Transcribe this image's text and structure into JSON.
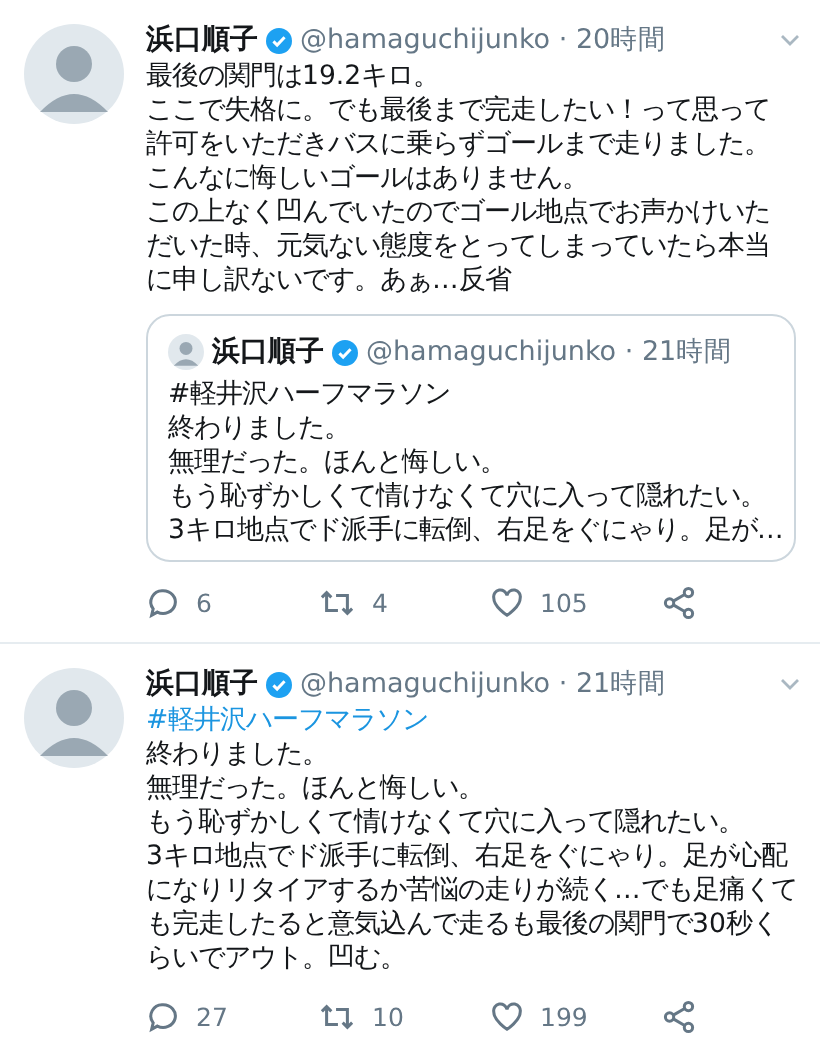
{
  "tweets": [
    {
      "author": "浜口順子",
      "verified": true,
      "meta": "@hamaguchijunko · 20時間",
      "lines": [
        {
          "kind": "text",
          "text": "最後の関門は19.2キロ。"
        },
        {
          "kind": "text",
          "text": "ここで失格に。でも最後まで完走したい！って思って"
        },
        {
          "kind": "text",
          "text": "許可をいただきバスに乗らずゴールまで走りました。"
        },
        {
          "kind": "text",
          "text": "こんなに悔しいゴールはありません。"
        },
        {
          "kind": "text",
          "text": "この上なく凹んでいたのでゴール地点でお声かけいた"
        },
        {
          "kind": "text",
          "text": "だいた時、元気ない態度をとってしまっていたら本当"
        },
        {
          "kind": "text",
          "text": "に申し訳ないです。あぁ…反省"
        }
      ],
      "quote": {
        "author": "浜口順子",
        "verified": true,
        "meta": "@hamaguchijunko · 21時間",
        "lines": [
          {
            "kind": "text",
            "text": "#軽井沢ハーフマラソン"
          },
          {
            "kind": "text",
            "text": "終わりました。"
          },
          {
            "kind": "text",
            "text": "無理だった。ほんと悔しい。"
          },
          {
            "kind": "text",
            "text": "もう恥ずかしくて情けなくて穴に入って隠れたい。"
          },
          {
            "kind": "text",
            "text": "3キロ地点でド派手に転倒、右足をぐにゃり。足が…"
          }
        ]
      },
      "replies": "6",
      "retweets": "4",
      "likes": "105"
    },
    {
      "author": "浜口順子",
      "verified": true,
      "meta": "@hamaguchijunko · 21時間",
      "lines": [
        {
          "kind": "hashtag",
          "text": "#軽井沢ハーフマラソン"
        },
        {
          "kind": "text",
          "text": "終わりました。"
        },
        {
          "kind": "text",
          "text": "無理だった。ほんと悔しい。"
        },
        {
          "kind": "text",
          "text": "もう恥ずかしくて情けなくて穴に入って隠れたい。"
        },
        {
          "kind": "text",
          "text": "3キロ地点でド派手に転倒、右足をぐにゃり。足が心配"
        },
        {
          "kind": "text",
          "text": "になりリタイアするか苦悩の走りが続く…でも足痛くて"
        },
        {
          "kind": "text",
          "text": "も完走したると意気込んで走るも最後の関門で30秒く"
        },
        {
          "kind": "text",
          "text": "らいでアウト。凹む。"
        }
      ],
      "replies": "27",
      "retweets": "10",
      "likes": "199"
    }
  ]
}
